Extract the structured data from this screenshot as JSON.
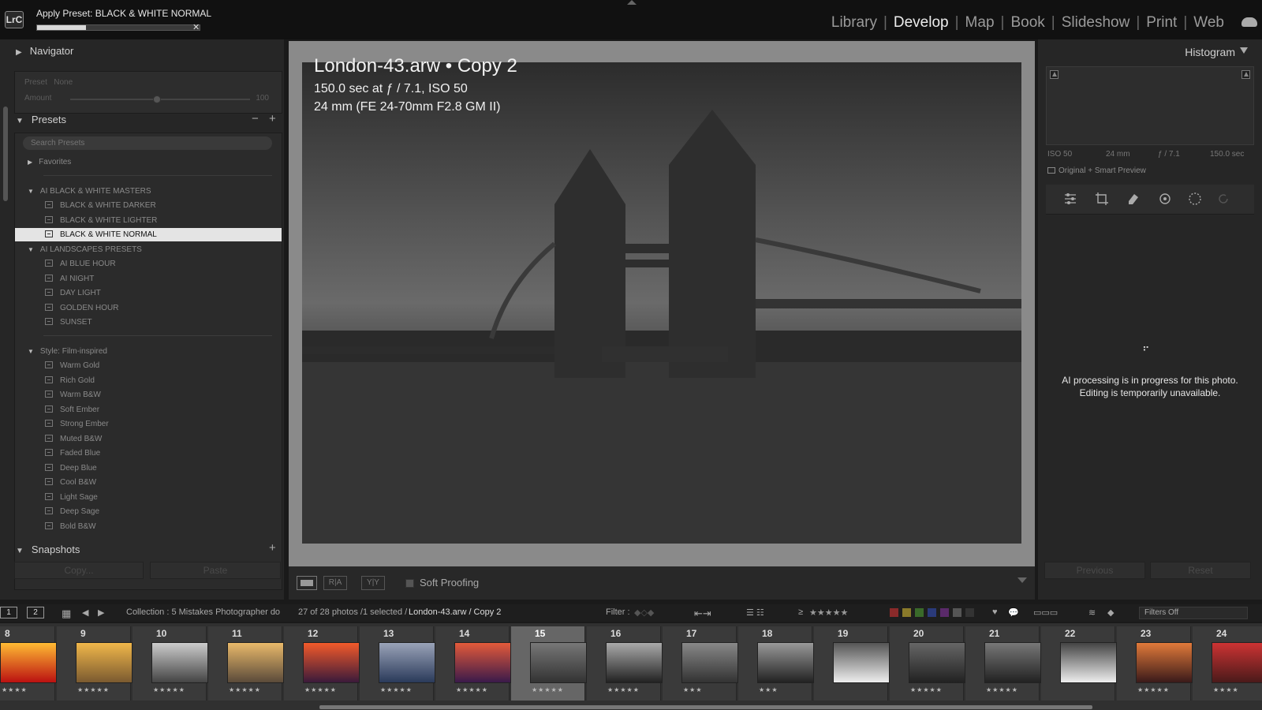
{
  "topbar": {
    "logo": "LrC",
    "task_label": "Apply Preset: BLACK & WHITE NORMAL",
    "task_progress": 0.3,
    "modules": [
      "Library",
      "Develop",
      "Map",
      "Book",
      "Slideshow",
      "Print",
      "Web"
    ],
    "active_module": "Develop"
  },
  "left": {
    "navigator_label": "Navigator",
    "preset_label": "Preset",
    "preset_value": "None",
    "amount_label": "Amount",
    "amount_value": "100",
    "presets_label": "Presets",
    "search_placeholder": "Search Presets",
    "tree": [
      {
        "type": "group",
        "label": "Favorites",
        "open": false
      },
      {
        "type": "divider"
      },
      {
        "type": "group",
        "label": "AI BLACK & WHITE MASTERS",
        "open": true
      },
      {
        "type": "leaf",
        "label": "BLACK & WHITE DARKER"
      },
      {
        "type": "leaf",
        "label": "BLACK & WHITE LIGHTER"
      },
      {
        "type": "leaf",
        "label": "BLACK & WHITE NORMAL",
        "selected": true
      },
      {
        "type": "group",
        "label": "AI LANDSCAPES PRESETS",
        "open": true
      },
      {
        "type": "leaf",
        "label": "AI BLUE HOUR"
      },
      {
        "type": "leaf",
        "label": "AI NIGHT"
      },
      {
        "type": "leaf",
        "label": "DAY LIGHT"
      },
      {
        "type": "leaf",
        "label": "GOLDEN HOUR"
      },
      {
        "type": "leaf",
        "label": "SUNSET"
      },
      {
        "type": "divider"
      },
      {
        "type": "group",
        "label": "Style: Film-inspired",
        "open": true
      },
      {
        "type": "leaf",
        "label": "Warm Gold"
      },
      {
        "type": "leaf",
        "label": "Rich Gold"
      },
      {
        "type": "leaf",
        "label": "Warm B&W"
      },
      {
        "type": "leaf",
        "label": "Soft Ember"
      },
      {
        "type": "leaf",
        "label": "Strong Ember"
      },
      {
        "type": "leaf",
        "label": "Muted B&W"
      },
      {
        "type": "leaf",
        "label": "Faded Blue"
      },
      {
        "type": "leaf",
        "label": "Deep Blue"
      },
      {
        "type": "leaf",
        "label": "Cool B&W"
      },
      {
        "type": "leaf",
        "label": "Light Sage"
      },
      {
        "type": "leaf",
        "label": "Deep Sage"
      },
      {
        "type": "leaf",
        "label": "Bold B&W"
      }
    ],
    "snapshots_label": "Snapshots",
    "copy_label": "Copy...",
    "paste_label": "Paste"
  },
  "photo": {
    "title": "London-43.arw  •  Copy 2",
    "exposure": "150.0 sec at ƒ / 7.1, ISO 50",
    "lens": "24 mm (FE 24-70mm F2.8 GM II)"
  },
  "toolbar": {
    "soft_proofing_label": "Soft Proofing"
  },
  "right": {
    "histogram_label": "Histogram",
    "iso": "ISO 50",
    "focal": "24 mm",
    "aperture": "ƒ / 7.1",
    "shutter": "150.0 sec",
    "original_label": "Original + Smart Preview",
    "ai_msg_1": "AI processing is in progress for this photo.",
    "ai_msg_2": "Editing is temporarily unavailable.",
    "previous_label": "Previous",
    "reset_label": "Reset"
  },
  "filmbar": {
    "screen1": "1",
    "screen2": "2",
    "collection": "Collection : 5 Mistakes Photographer do",
    "count": "27 of 28 photos /1 selected /",
    "file": "London-43.arw / Copy 2",
    "filter_label": "Filter :",
    "rating_op": "≥",
    "filters_off": "Filters Off",
    "label_colors": [
      "#8a2a2a",
      "#8a7a2a",
      "#3a6a2a",
      "#2a3a7a",
      "#5a2a6a",
      "#555555",
      "#333333"
    ]
  },
  "filmstrip": [
    {
      "num": "8",
      "stars": "★★★★",
      "c1": "#b11",
      "c2": "#fb3"
    },
    {
      "num": "9",
      "stars": "★★★★★",
      "c1": "#7a5a30",
      "c2": "#f1b74a"
    },
    {
      "num": "10",
      "stars": "★★★★★",
      "c1": "#444",
      "c2": "#ccc"
    },
    {
      "num": "11",
      "stars": "★★★★★",
      "c1": "#5a4a3a",
      "c2": "#e9b96a"
    },
    {
      "num": "12",
      "stars": "★★★★★",
      "c1": "#3a1a3a",
      "c2": "#f35a2a"
    },
    {
      "num": "13",
      "stars": "★★★★★",
      "c1": "#2a3a5a",
      "c2": "#9aa3b8"
    },
    {
      "num": "14",
      "stars": "★★★★★",
      "c1": "#3a1a4a",
      "c2": "#e35a3a"
    },
    {
      "num": "15",
      "stars": "★★★★★",
      "c1": "#333",
      "c2": "#777",
      "active": true
    },
    {
      "num": "16",
      "stars": "★★★★★",
      "c1": "#222",
      "c2": "#aaa"
    },
    {
      "num": "17",
      "stars": "★★★",
      "c1": "#333",
      "c2": "#888"
    },
    {
      "num": "18",
      "stars": "★★★",
      "c1": "#222",
      "c2": "#999"
    },
    {
      "num": "19",
      "stars": "",
      "c1": "#eee",
      "c2": "#555"
    },
    {
      "num": "20",
      "stars": "★★★★★",
      "c1": "#222",
      "c2": "#666"
    },
    {
      "num": "21",
      "stars": "★★★★★",
      "c1": "#222",
      "c2": "#777"
    },
    {
      "num": "22",
      "stars": "",
      "c1": "#eee",
      "c2": "#444"
    },
    {
      "num": "23",
      "stars": "★★★★★",
      "c1": "#3a1a1a",
      "c2": "#e17a3a"
    },
    {
      "num": "24",
      "stars": "★★★★",
      "c1": "#4a1a1a",
      "c2": "#c33"
    }
  ]
}
